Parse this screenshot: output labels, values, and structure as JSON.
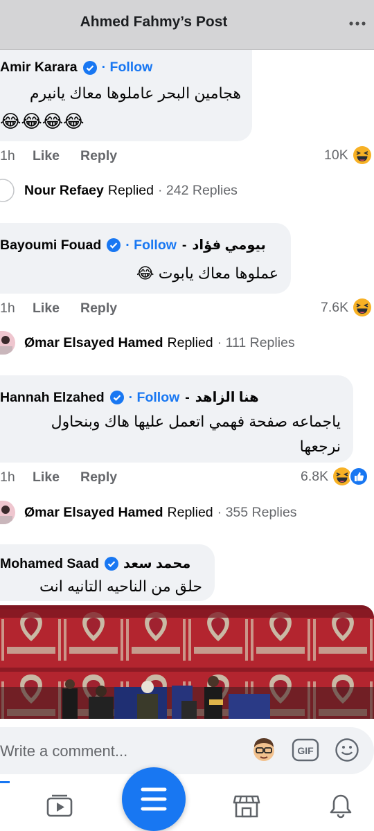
{
  "header": {
    "title": "Ahmed Fahmy’s Post",
    "more_icon": "more-dots-icon"
  },
  "comments": [
    {
      "author": "Amir Karara",
      "author_ar": "",
      "follow": "· Follow",
      "text": "هجامين البحر عاملوها معاك يانيرم",
      "emoji_line": "😂😂😂😂",
      "time": "1h",
      "like": "Like",
      "reply": "Reply",
      "reactions": "10K",
      "reaction_icons": [
        "haha-icon"
      ],
      "replied_by": "Nour Refaey",
      "replied_word": "Replied",
      "replies": "· 242 Replies"
    },
    {
      "author": "Bayoumi Fouad",
      "author_ar": "بيومي  فؤاد",
      "follow": "· Follow",
      "text": "عملوها معاك يابوت 😂",
      "time": "1h",
      "like": "Like",
      "reply": "Reply",
      "reactions": "7.6K",
      "reaction_icons": [
        "haha-icon"
      ],
      "replied_by": "Ømar Elsayed Hamed",
      "replied_word": "Replied",
      "replies": "· 111 Replies"
    },
    {
      "author": "Hannah Elzahed",
      "author_ar": "هنا  الزاهد",
      "follow": "· Follow",
      "text_line1": "ياجماعه صفحة فهمي اتعمل عليها  هاك وبنحاول",
      "text_line2": "نرجعها",
      "time": "1h",
      "like": "Like",
      "reply": "Reply",
      "reactions": "6.8K",
      "reaction_icons": [
        "haha-icon",
        "like-icon"
      ],
      "replied_by": "Ømar Elsayed Hamed",
      "replied_word": "Replied",
      "replies": "· 355 Replies"
    },
    {
      "author": "Mohamed Saad",
      "author_ar": "محمد سعد",
      "text": "حلق من الناحيه التانيه انت"
    }
  ],
  "composer": {
    "placeholder": "Write a comment...",
    "icons": [
      "avatar-emoji-icon",
      "gif-icon",
      "smile-icon"
    ]
  },
  "tabbar": {
    "tabs": [
      "video-tab-icon",
      "menu-fab-icon",
      "marketplace-icon",
      "bell-icon"
    ]
  },
  "colors": {
    "accent": "#1877f2",
    "bubble": "#f0f2f5",
    "header": "#d4d4d6",
    "meta": "#65676b"
  }
}
